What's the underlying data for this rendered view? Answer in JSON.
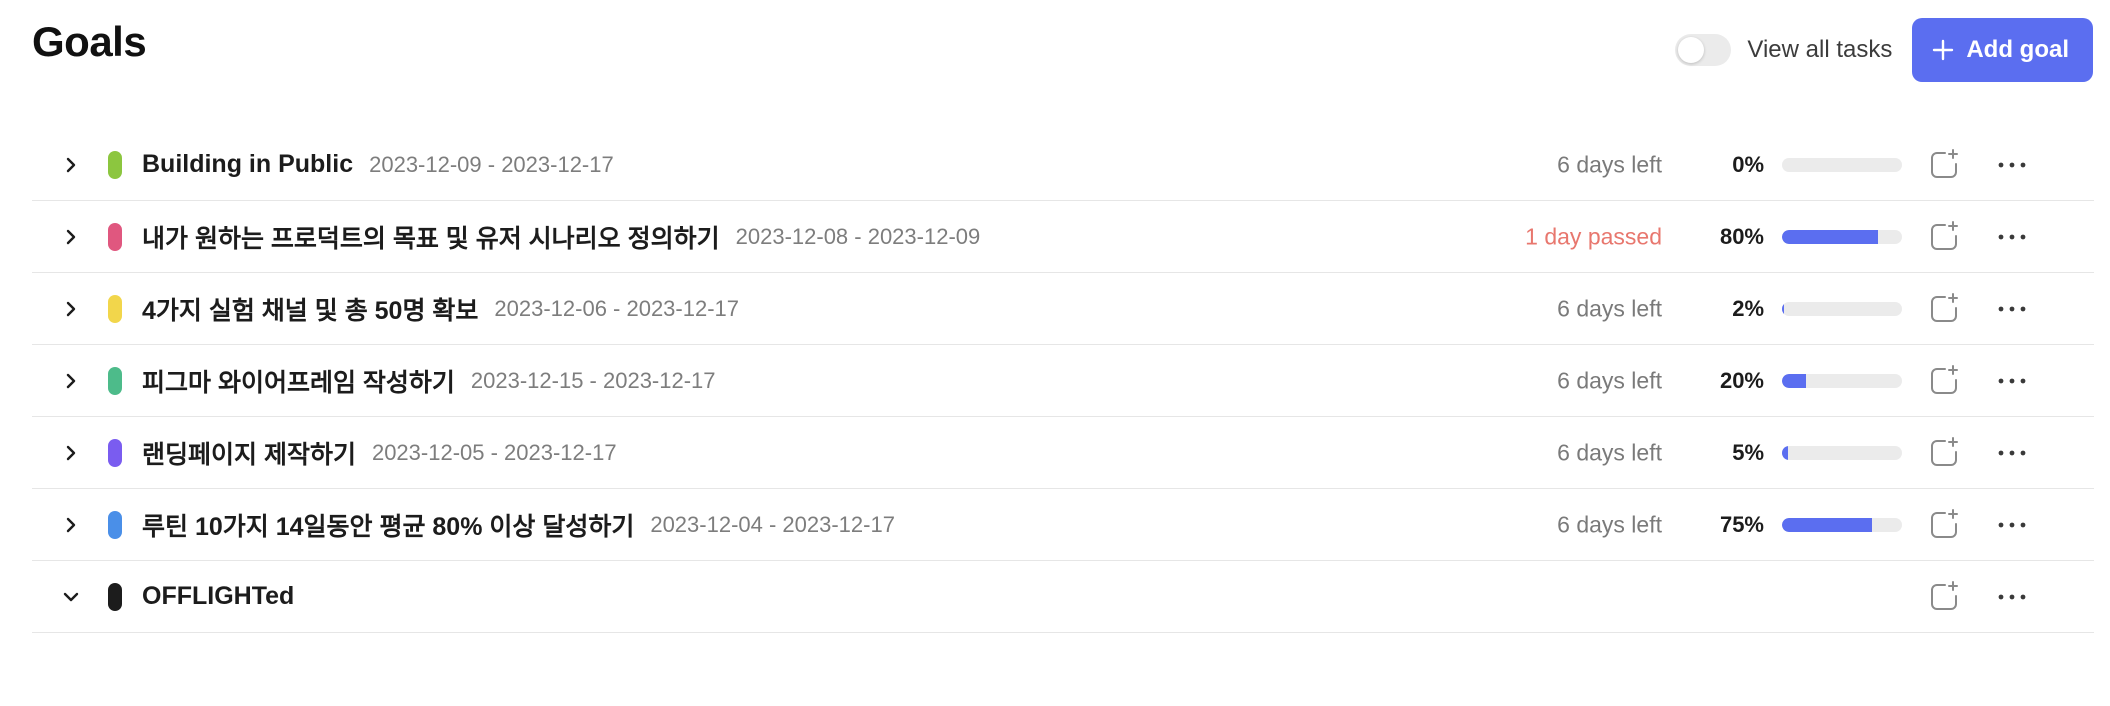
{
  "page": {
    "title": "Goals"
  },
  "header": {
    "toggle_label": "View all tasks",
    "toggle_on": false,
    "add_goal_label": "Add goal",
    "accent_color": "#5b6ef0"
  },
  "goals": [
    {
      "title": "Building in Public",
      "dates": "2023-12-09 - 2023-12-17",
      "status": "6 days left",
      "status_type": "left",
      "percent_label": "0%",
      "progress": 0,
      "color": "#8cc63f",
      "expanded": false
    },
    {
      "title": "내가 원하는 프로덕트의 목표 및 유저 시나리오 정의하기",
      "dates": "2023-12-08 - 2023-12-09",
      "status": "1 day passed",
      "status_type": "passed",
      "percent_label": "80%",
      "progress": 0.8,
      "color": "#e0577f",
      "expanded": false
    },
    {
      "title": "4가지 실험 채널 및 총 50명 확보",
      "dates": "2023-12-06 - 2023-12-17",
      "status": "6 days left",
      "status_type": "left",
      "percent_label": "2%",
      "progress": 0.02,
      "color": "#f2d64b",
      "expanded": false
    },
    {
      "title": " 피그마 와이어프레임 작성하기",
      "dates": "2023-12-15 - 2023-12-17",
      "status": "6 days left",
      "status_type": "left",
      "percent_label": "20%",
      "progress": 0.2,
      "color": "#4dbb8a",
      "expanded": false
    },
    {
      "title": "랜딩페이지 제작하기",
      "dates": "2023-12-05 - 2023-12-17",
      "status": "6 days left",
      "status_type": "left",
      "percent_label": "5%",
      "progress": 0.05,
      "color": "#7a5cf0",
      "expanded": false
    },
    {
      "title": "루틴 10가지 14일동안 평균 80% 이상 달성하기",
      "dates": "2023-12-04 - 2023-12-17",
      "status": "6 days left",
      "status_type": "left",
      "percent_label": "75%",
      "progress": 0.75,
      "color": "#4a8fe8",
      "expanded": false
    },
    {
      "title": "OFFLIGHTed",
      "dates": "",
      "status": "",
      "status_type": "none",
      "percent_label": "",
      "progress": null,
      "color": "#1c1c1c",
      "expanded": true
    }
  ],
  "icons": {
    "collapse": "chevron-right-icon",
    "expand": "chevron-down-icon",
    "add_subtask": "add-subtask-icon",
    "more": "more-horizontal-icon",
    "add": "plus-icon"
  }
}
